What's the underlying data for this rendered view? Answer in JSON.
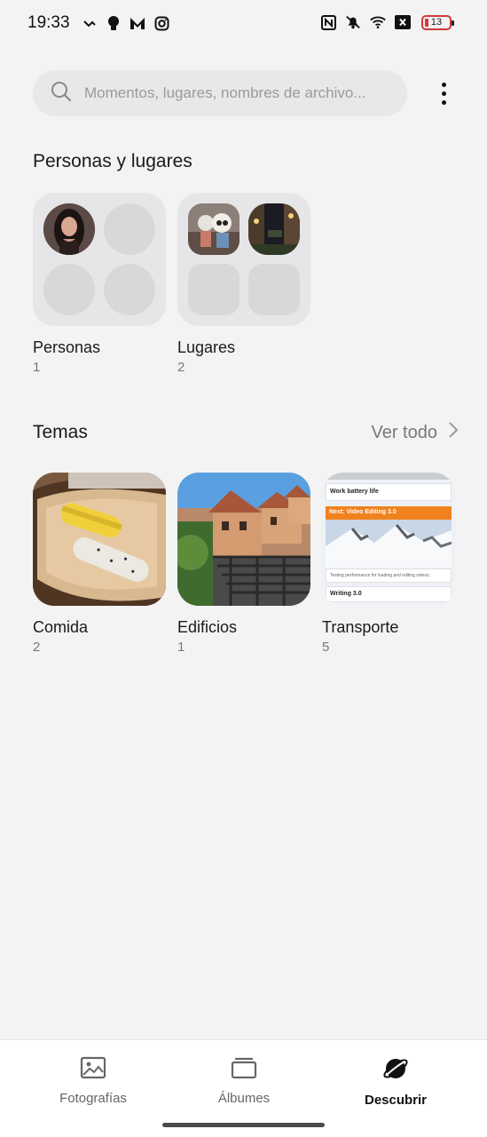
{
  "status_bar": {
    "time": "19:33",
    "battery": "13",
    "left_icons": [
      "missed-call-icon",
      "bulb-icon",
      "m-app-icon",
      "instagram-icon"
    ],
    "right_icons": [
      "nfc-icon",
      "mute-icon",
      "wifi-icon",
      "no-sim-icon",
      "battery-icon"
    ]
  },
  "search": {
    "placeholder": "Momentos, lugares, nombres de archivo..."
  },
  "people_places": {
    "title": "Personas y lugares",
    "items": [
      {
        "label": "Personas",
        "count": "1"
      },
      {
        "label": "Lugares",
        "count": "2"
      }
    ]
  },
  "themes": {
    "title": "Temas",
    "see_all": "Ver todo",
    "items": [
      {
        "label": "Comida",
        "count": "2"
      },
      {
        "label": "Edificios",
        "count": "1"
      },
      {
        "label": "Transporte",
        "count": "5"
      }
    ],
    "transport_thumb": {
      "line1": "Work battery life",
      "line2": "Next: Video Editing 3.0",
      "line3": "Testing performance for loading and editing videos.",
      "line4": "Writing 3.0"
    }
  },
  "bottom_nav": {
    "items": [
      {
        "label": "Fotografías",
        "icon": "photo-icon",
        "active": false
      },
      {
        "label": "Álbumes",
        "icon": "albums-icon",
        "active": false
      },
      {
        "label": "Descubrir",
        "icon": "planet-icon",
        "active": true
      }
    ]
  },
  "colors": {
    "background": "#f3f3f4",
    "accent_orange": "#f0821e",
    "battery_low": "#d03a3a"
  }
}
